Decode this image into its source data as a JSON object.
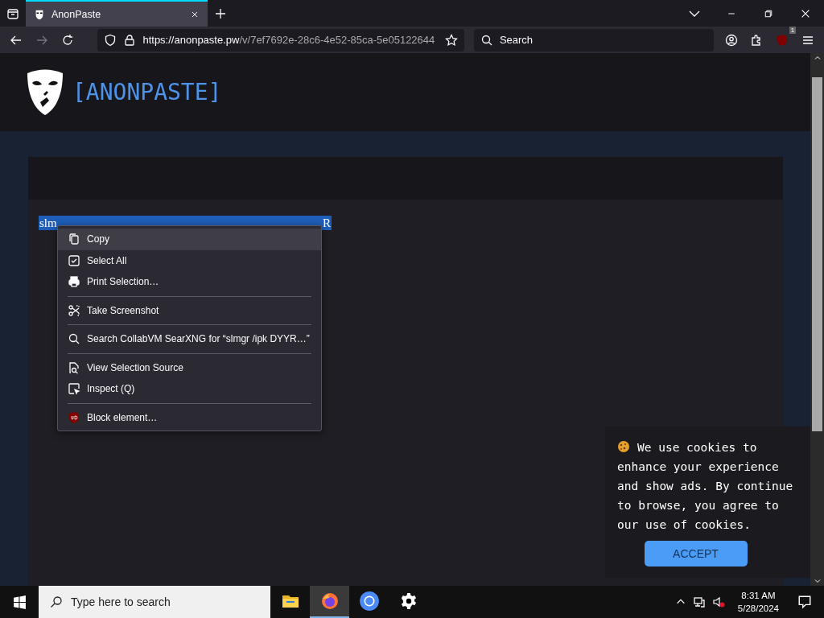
{
  "browser": {
    "tabs": [
      {
        "title": "AnonPaste",
        "selected": true
      }
    ],
    "url": {
      "host": "https://anonpaste.pw",
      "path": "/v/7ef7692e-28c6-4e52-85ca-5e05122644"
    },
    "search": {
      "placeholder": "Search"
    },
    "extension_badge": "1"
  },
  "page": {
    "logo_text": "[ANONPASTE]",
    "selection": {
      "start": "slm",
      "end": "R"
    }
  },
  "context_menu": {
    "items": [
      {
        "kind": "item",
        "label": "Copy",
        "selected": true
      },
      {
        "kind": "item",
        "label": "Select All",
        "selected": false
      },
      {
        "kind": "item",
        "label": "Print Selection…",
        "selected": false
      },
      {
        "kind": "separator"
      },
      {
        "kind": "item",
        "label": "Take Screenshot",
        "selected": false
      },
      {
        "kind": "separator"
      },
      {
        "kind": "item",
        "label": "Search CollabVM SearXNG for “slmgr /ipk DYYR…”",
        "selected": false
      },
      {
        "kind": "separator"
      },
      {
        "kind": "item",
        "label": "View Selection Source",
        "selected": false
      },
      {
        "kind": "item",
        "label": "Inspect (Q)",
        "selected": false
      },
      {
        "kind": "separator"
      },
      {
        "kind": "item",
        "label": "Block element…",
        "selected": false
      }
    ]
  },
  "cookie_banner": {
    "text": "We use cookies to enhance your experience and show ads. By continue to browse, you agree to our use of cookies.",
    "button": "ACCEPT"
  },
  "taskbar": {
    "search_placeholder": "Type here to search",
    "apps": [
      {
        "selected": false
      },
      {
        "selected": true
      },
      {
        "selected": false
      },
      {
        "selected": false
      }
    ],
    "time": "8:31 AM",
    "date": "5/28/2024"
  }
}
